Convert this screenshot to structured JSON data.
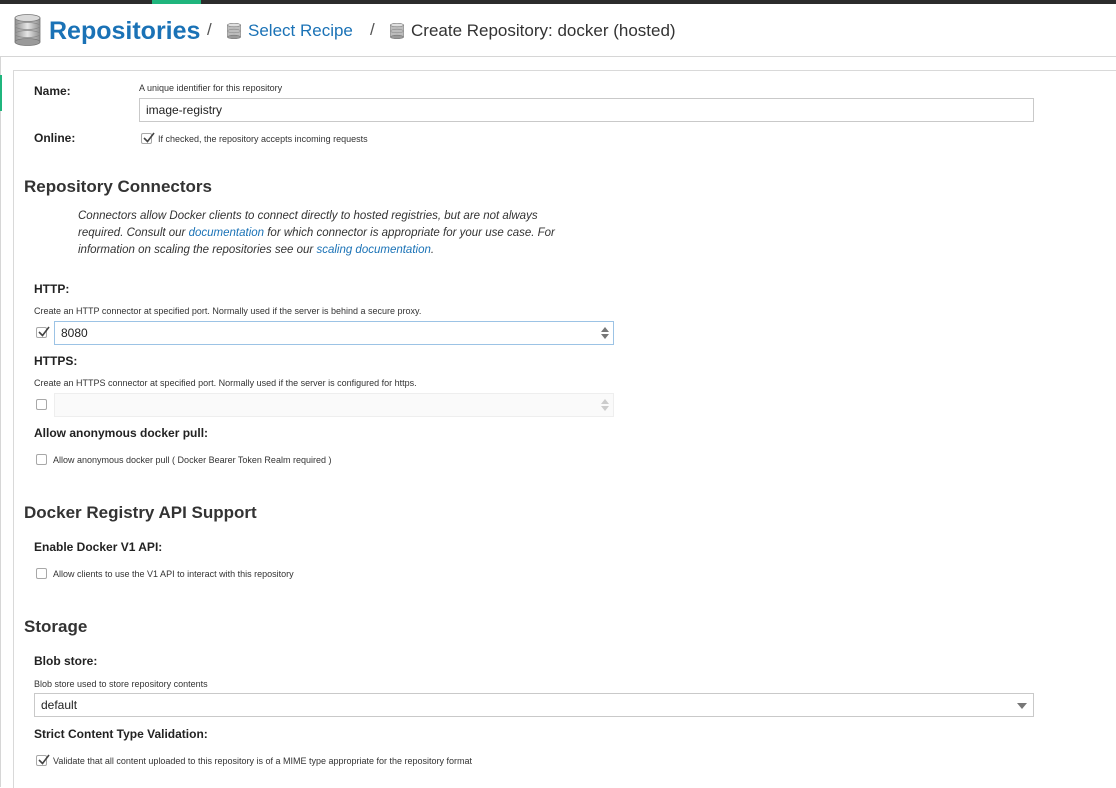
{
  "breadcrumb": {
    "title": "Repositories",
    "separator": "/",
    "select_recipe": "Select Recipe",
    "current": "Create Repository: docker (hosted)"
  },
  "form": {
    "name": {
      "label": "Name:",
      "help": "A unique identifier for this repository",
      "value": "image-registry"
    },
    "online": {
      "label": "Online:",
      "checkbox_label": "If checked, the repository accepts incoming requests",
      "checked": true
    }
  },
  "connectors": {
    "heading": "Repository Connectors",
    "intro": {
      "part1": "Connectors allow Docker clients to connect directly to hosted registries, but are not always required. Consult our ",
      "link1": "documentation",
      "part2": " for which connector is appropriate for your use case. For information on scaling the repositories see our ",
      "link2": "scaling documentation",
      "part3": "."
    },
    "http": {
      "label": "HTTP:",
      "help": "Create an HTTP connector at specified port. Normally used if the server is behind a secure proxy.",
      "checked": true,
      "value": "8080"
    },
    "https": {
      "label": "HTTPS:",
      "help": "Create an HTTPS connector at specified port. Normally used if the server is configured for https.",
      "checked": false,
      "value": ""
    },
    "anon": {
      "label": "Allow anonymous docker pull:",
      "checkbox_label": "Allow anonymous docker pull ( Docker Bearer Token Realm required )",
      "checked": false
    }
  },
  "docker_api": {
    "heading": "Docker Registry API Support",
    "v1": {
      "label": "Enable Docker V1 API:",
      "checkbox_label": "Allow clients to use the V1 API to interact with this repository",
      "checked": false
    }
  },
  "storage": {
    "heading": "Storage",
    "blob": {
      "label": "Blob store:",
      "help": "Blob store used to store repository contents",
      "value": "default"
    },
    "strict": {
      "label": "Strict Content Type Validation:",
      "checkbox_label": "Validate that all content uploaded to this repository is of a MIME type appropriate for the repository format",
      "checked": true
    }
  },
  "colors": {
    "accent": "#1fb57d",
    "link": "#1a72b6",
    "topbar": "#2c2c2c"
  },
  "icons": [
    "database-icon",
    "checkmark-icon",
    "spinner-arrows-icon",
    "chevron-down-icon"
  ]
}
